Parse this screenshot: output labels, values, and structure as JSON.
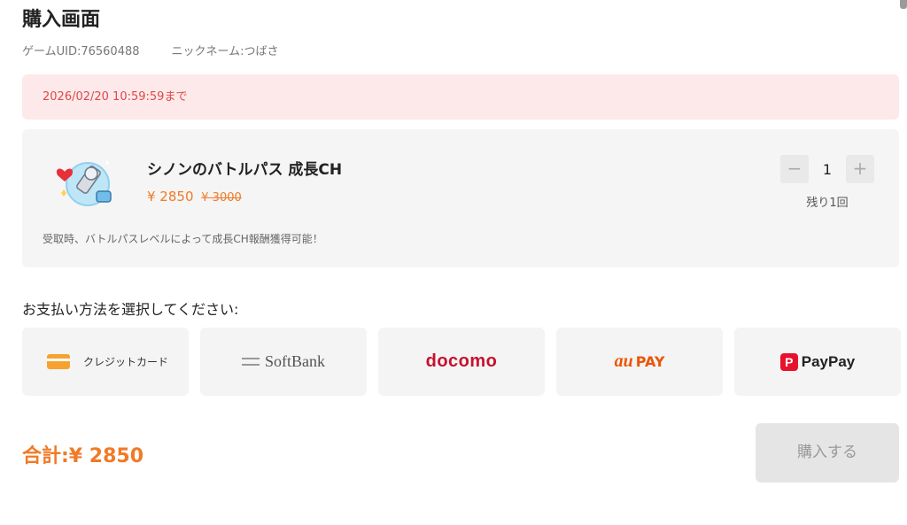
{
  "page": {
    "title": "購入画面",
    "game_uid_label": "ゲームUID:76560488",
    "nickname_label": "ニックネーム:つばさ"
  },
  "deadline": {
    "text": "2026/02/20 10:59:59まで",
    "color": "#e04848"
  },
  "product": {
    "icon": "battle-pass-icon",
    "name": "シノンのバトルパス 成長CH",
    "price_current": "¥ 2850",
    "price_original": "¥ 3000",
    "description": "受取時、バトルパスレベルによって成長CH報酬獲得可能！",
    "quantity": "1",
    "decrement": "−",
    "increment": "+",
    "remaining": "残り1回"
  },
  "payment": {
    "heading": "お支払い方法を選択してください:",
    "methods": {
      "credit": "クレジットカード",
      "softbank": "SoftBank",
      "docomo": "docomo",
      "au_mark": "au",
      "au_pay": "PAY",
      "paypay": "PayPay"
    }
  },
  "footer": {
    "total": "合計:¥ 2850",
    "buy_label": "購入する"
  },
  "colors": {
    "accent": "#f07a26",
    "deadline_bg": "#fde9ea",
    "card_bg": "#f5f5f5",
    "docomo": "#c8102e",
    "au": "#eb5505",
    "paypay": "#e8112d"
  }
}
